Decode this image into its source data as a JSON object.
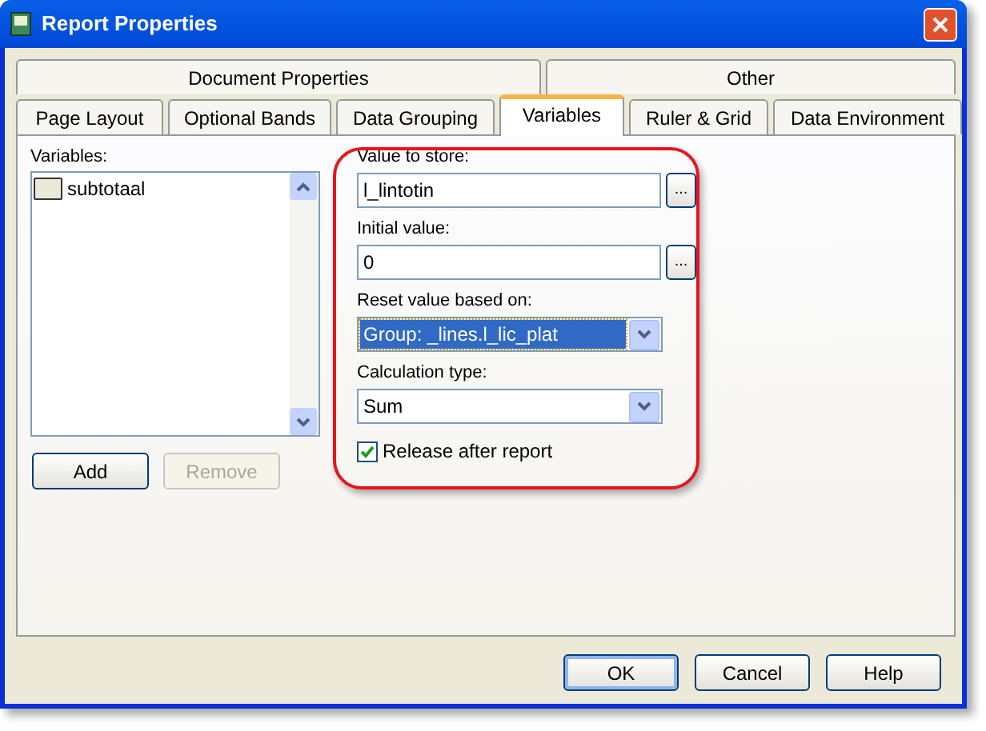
{
  "window": {
    "title": "Report Properties"
  },
  "tab_rows": [
    [
      {
        "label": "Document Properties",
        "selected": false
      },
      {
        "label": "Other",
        "selected": false
      }
    ],
    [
      {
        "label": "Page Layout",
        "selected": false
      },
      {
        "label": "Optional Bands",
        "selected": false
      },
      {
        "label": "Data Grouping",
        "selected": false
      },
      {
        "label": "Variables",
        "selected": true
      },
      {
        "label": "Ruler & Grid",
        "selected": false
      },
      {
        "label": "Data Environment",
        "selected": false
      }
    ]
  ],
  "variables": {
    "label": "Variables:",
    "items": [
      {
        "name": "subtotaal",
        "selected": false
      }
    ],
    "buttons": [
      {
        "label": "Add",
        "disabled": false
      },
      {
        "label": "Remove",
        "disabled": true
      }
    ]
  },
  "form": [
    {
      "kind": "text",
      "label": "Value to store:",
      "value": "l_lintotin"
    },
    {
      "kind": "text",
      "label": "Initial value:",
      "value": "0"
    },
    {
      "kind": "select",
      "label": "Reset value based on:",
      "value": "Group: _lines.l_lic_plat",
      "focused": true
    },
    {
      "kind": "select",
      "label": "Calculation type:",
      "value": "Sum",
      "focused": false
    }
  ],
  "release": {
    "label": "Release after report",
    "checked": true
  },
  "buttons": [
    {
      "label": "OK",
      "default": true
    },
    {
      "label": "Cancel",
      "default": false
    },
    {
      "label": "Help",
      "default": false
    }
  ],
  "dots_label": "..."
}
